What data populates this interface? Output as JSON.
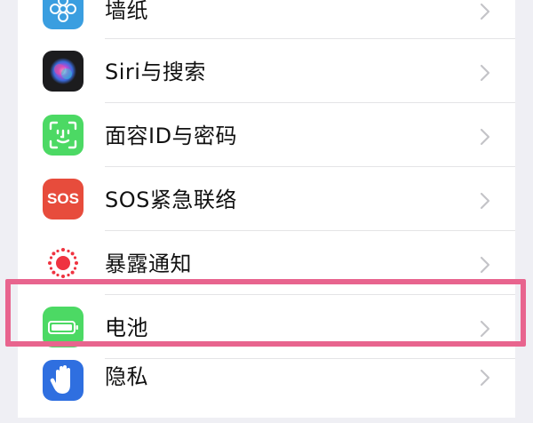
{
  "settings": {
    "items": [
      {
        "label": "墙纸",
        "icon": "wallpaper-flower-icon",
        "color": "#3a9ee0"
      },
      {
        "label": "Siri与搜索",
        "icon": "siri-icon",
        "color": "#1c1c1e"
      },
      {
        "label": "面容ID与密码",
        "icon": "face-id-icon",
        "color": "#4cd964"
      },
      {
        "label": "SOS紧急联络",
        "icon": "sos-icon",
        "color": "#e74c3c",
        "icon_text": "SOS"
      },
      {
        "label": "暴露通知",
        "icon": "exposure-notification-icon",
        "color": "#ffffff"
      },
      {
        "label": "电池",
        "icon": "battery-icon",
        "color": "#4cd964",
        "highlighted": true
      },
      {
        "label": "隐私",
        "icon": "privacy-hand-icon",
        "color": "#2f6fe0"
      }
    ]
  },
  "highlight_color": "#e8648e"
}
